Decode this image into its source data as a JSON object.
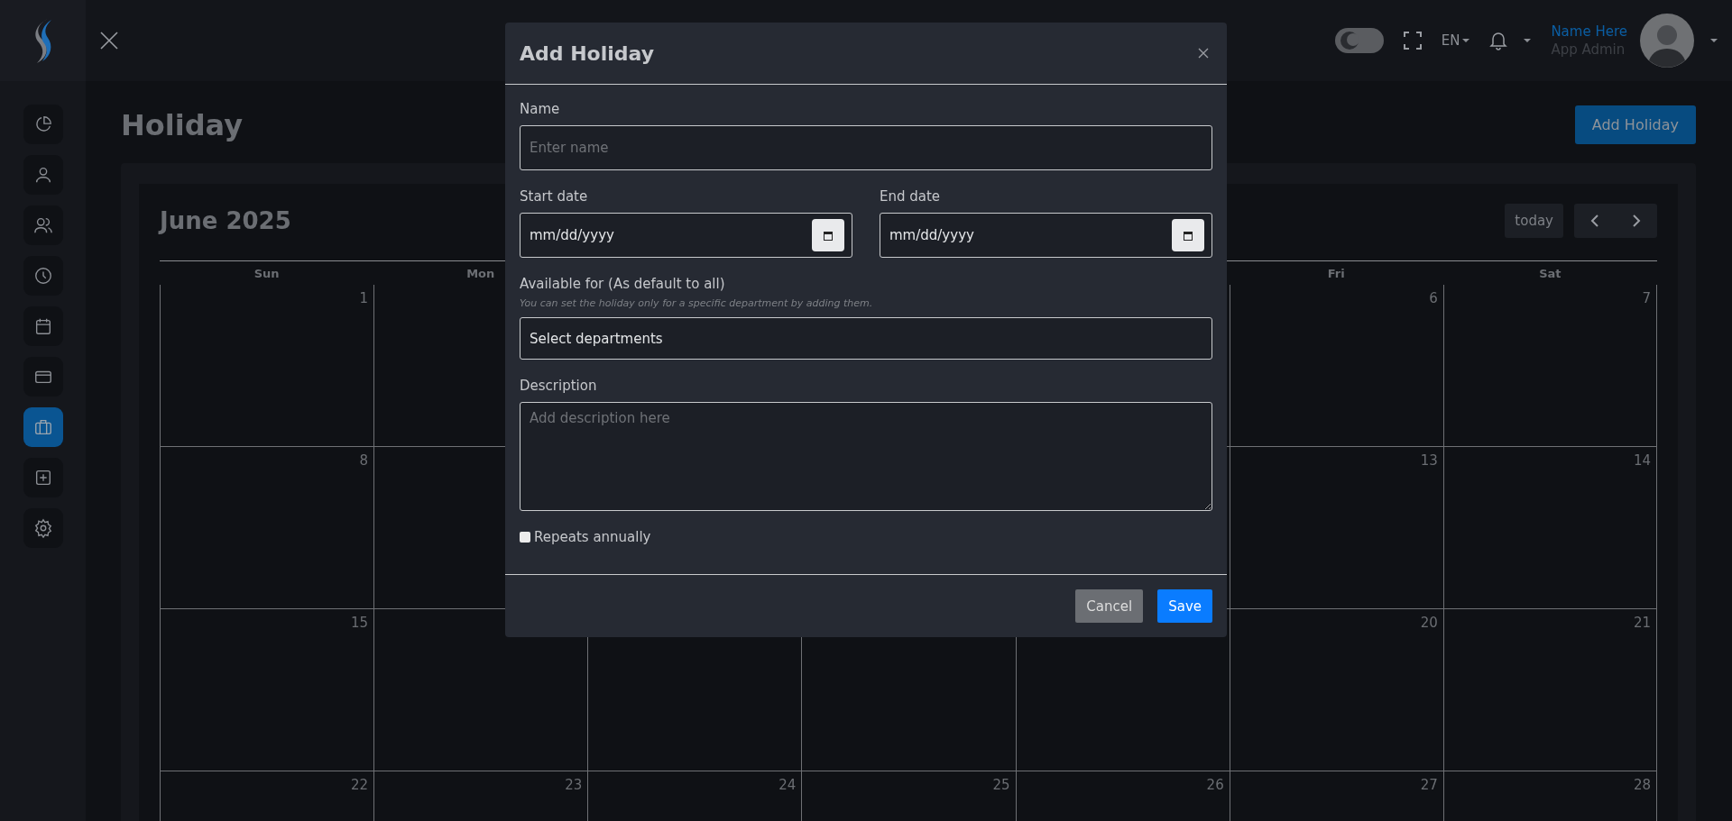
{
  "topbar": {
    "language": "EN",
    "user": {
      "name": "Name Here",
      "role": "App Admin"
    }
  },
  "sidebar": {
    "items": [
      {
        "kind": "chart",
        "selected": false
      },
      {
        "kind": "user",
        "selected": false
      },
      {
        "kind": "users",
        "selected": false
      },
      {
        "kind": "clock",
        "selected": false
      },
      {
        "kind": "calendar",
        "selected": false
      },
      {
        "kind": "card",
        "selected": false
      },
      {
        "kind": "briefcase",
        "selected": true
      },
      {
        "kind": "plus",
        "selected": false
      },
      {
        "kind": "gear",
        "selected": false
      }
    ]
  },
  "page": {
    "title": "Holiday",
    "add_button": "Add Holiday"
  },
  "calendar": {
    "title": "June 2025",
    "today_button": "today",
    "weekdays": [
      {
        "label": "Sun",
        "kind": "sun"
      },
      {
        "label": "Mon",
        "kind": "mon"
      },
      {
        "label": "Fri",
        "kind": "fri"
      },
      {
        "label": "Sat",
        "kind": "sat"
      }
    ],
    "weeks": [
      [
        {
          "day": "1",
          "kind": "sun"
        },
        {
          "day": "6",
          "kind": "fri"
        },
        {
          "day": "7",
          "kind": "sat"
        }
      ],
      [
        {
          "day": "8",
          "kind": "sun"
        },
        {
          "day": "13",
          "kind": "fri"
        },
        {
          "day": "14",
          "kind": "sat"
        }
      ],
      [
        {
          "day": "15",
          "kind": "sun"
        },
        {
          "day": "20",
          "kind": "fri"
        },
        {
          "day": "21",
          "kind": "sat"
        }
      ],
      [
        {
          "day": "22",
          "kind": "sun"
        },
        {
          "day": "23",
          "kind": "mon"
        },
        {
          "day": "24",
          "kind": "tue"
        },
        {
          "day": "25",
          "kind": "wed"
        },
        {
          "day": "26",
          "kind": "thu"
        },
        {
          "day": "27",
          "kind": "fri"
        },
        {
          "day": "28",
          "kind": "sat"
        }
      ]
    ]
  },
  "modal": {
    "title": "Add Holiday",
    "fields": [
      {
        "kind": "text",
        "label": "Name",
        "placeholder": "Enter name"
      },
      {
        "kind": "dates",
        "items": [
          {
            "label": "Start date",
            "value": "mm/dd/yyyy"
          },
          {
            "label": "End date",
            "value": "mm/dd/yyyy"
          }
        ]
      },
      {
        "kind": "select",
        "label": "Available for (As default to all)",
        "hint": "You can set the holiday only for a specific department by adding them.",
        "value": "Select departments"
      },
      {
        "kind": "textarea",
        "label": "Description",
        "placeholder": "Add description here"
      }
    ],
    "checkbox": {
      "label": "Repeats annually",
      "checked": false
    },
    "buttons": [
      {
        "label": "Cancel",
        "kind": "secondary"
      },
      {
        "label": "Save",
        "kind": "primary"
      }
    ]
  }
}
